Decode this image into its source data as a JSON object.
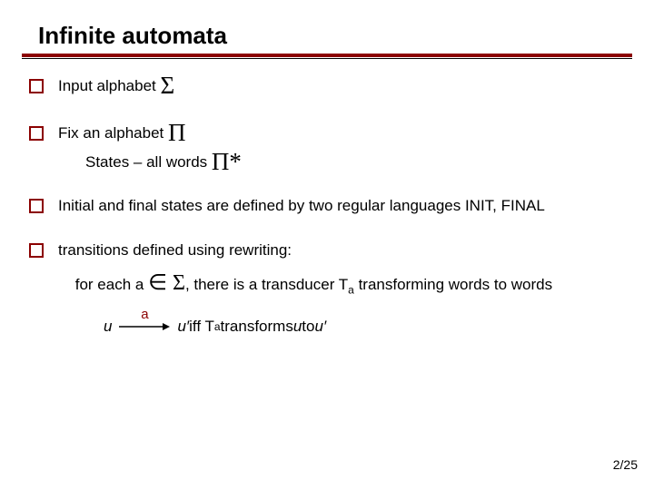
{
  "title": "Infinite automata",
  "bullets": {
    "b1": {
      "text": "Input alphabet ",
      "symbol": "Σ"
    },
    "b2": {
      "text": "Fix an alphabet ",
      "symbol": "Π",
      "sub": {
        "text_a": "States – all words ",
        "symbol": "Π*"
      }
    },
    "b3": {
      "text": "Initial and final states are defined by two regular languages INIT, FINAL"
    },
    "b4": {
      "text": "transitions defined using rewriting:",
      "sub": {
        "pre": "for each a ",
        "in": "∈",
        "sym": " Σ",
        "post1": ", there is a transducer T",
        "sub_a": "a",
        "post2": " transforming words to words"
      },
      "arrow": {
        "u": "u",
        "label": "a",
        "u2": "u′",
        "mid": "  iff T",
        "sub_a": "a",
        "tail1": " transforms ",
        "uv": "u",
        "to": " to ",
        "uv2": "u′"
      }
    }
  },
  "page": "2/25"
}
